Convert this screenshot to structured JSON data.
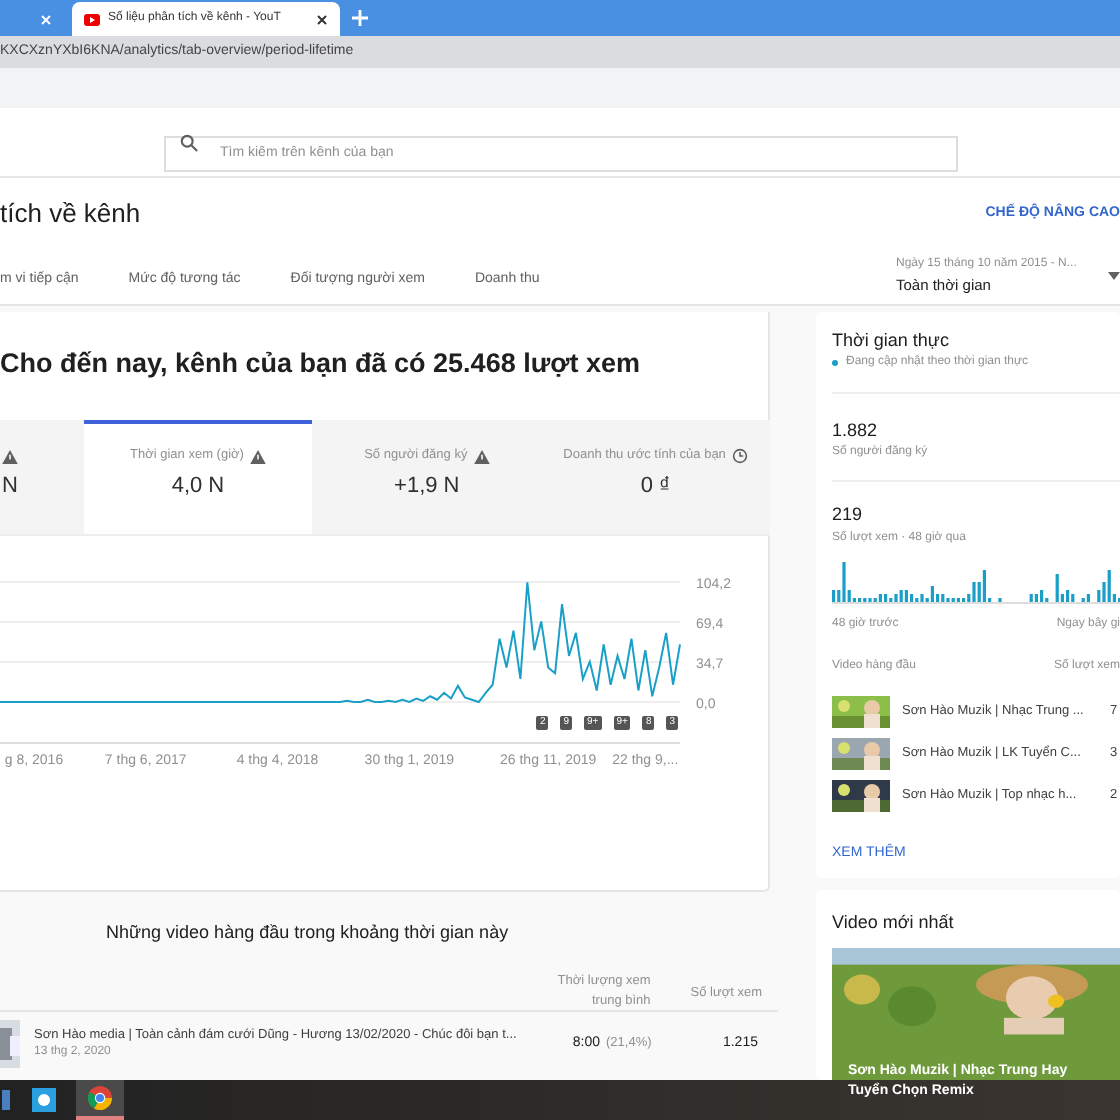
{
  "browser": {
    "tabs": [
      {
        "selected": false
      },
      {
        "title": "Số liệu phân tích về kênh - YouT",
        "selected": true
      }
    ],
    "url": "KXCXznYXbI6KNA/analytics/tab-overview/period-lifetime"
  },
  "search": {
    "placeholder": "Tìm kiếm trên kênh của bạn"
  },
  "page_title": "tích về kênh",
  "advanced_mode": "CHẾ ĐỘ NÂNG CAO",
  "nav_tabs": [
    {
      "label": "m vi tiếp cận",
      "selected": false
    },
    {
      "label": "Mức độ tương tác",
      "selected": false
    },
    {
      "label": "Đối tượng người xem",
      "selected": false
    },
    {
      "label": "Doanh thu",
      "selected": false
    }
  ],
  "date_range": {
    "range": "Ngày 15 tháng 10 năm 2015 - N...",
    "value": "Toàn thời gian"
  },
  "headline": "Cho đến nay, kênh của bạn đã có 25.468 lượt xem",
  "metrics": [
    {
      "value": "N",
      "selected": false
    },
    {
      "label": "Thời gian xem (giờ)",
      "value": "4,0 N",
      "selected": true
    },
    {
      "label": "Số người đăng ký",
      "value": "+1,9 N",
      "selected": false
    },
    {
      "label": "Doanh thu ước tính của bạn",
      "value": "0 ₫",
      "selected": false
    }
  ],
  "chart": {
    "chart_data": {
      "type": "line",
      "categories": [
        null,
        null,
        null,
        null,
        "g 8, 2016",
        null,
        null,
        null,
        null,
        null,
        null,
        null,
        null,
        null,
        null,
        null,
        null,
        null,
        null,
        null,
        null,
        "7 thg 6, 2017",
        null,
        null,
        null,
        null,
        null,
        null,
        null,
        null,
        null,
        null,
        null,
        null,
        null,
        null,
        null,
        null,
        null,
        null,
        "4 thg 4, 2018",
        null,
        null,
        null,
        null,
        null,
        null,
        null,
        null,
        null,
        null,
        null,
        null,
        null,
        null,
        null,
        null,
        null,
        null,
        "30 thg 1, 2019",
        null,
        null,
        null,
        null,
        null,
        null,
        null,
        null,
        null,
        null,
        null,
        null,
        null,
        null,
        null,
        null,
        null,
        null,
        null,
        "26 thg 11, 2019",
        null,
        null,
        null,
        null,
        null,
        null,
        null,
        null,
        null,
        null,
        null,
        null,
        null,
        "22 thg 9,...",
        null,
        null,
        null,
        null,
        null
      ],
      "ylim": [
        0,
        104.2
      ],
      "yticks": [
        {
          "value": 0,
          "label": "0,0"
        },
        {
          "value": 34.7,
          "label": "34,7"
        },
        {
          "value": 69.4,
          "label": "69,4"
        },
        {
          "value": 104.2,
          "label": "104,2"
        }
      ],
      "series": [
        {
          "color": "#1aa0c8",
          "values": [
            0,
            0,
            0,
            0,
            0,
            0,
            0,
            0,
            0,
            0,
            0,
            0,
            0,
            0,
            0,
            0,
            0,
            0,
            0,
            0,
            0,
            0,
            0,
            0,
            0,
            0,
            0,
            0,
            0,
            0,
            0,
            0,
            0,
            0,
            0,
            0,
            0,
            0,
            0,
            0,
            0,
            0,
            0,
            0,
            0,
            0,
            0,
            0,
            0,
            0,
            1,
            0,
            0,
            2,
            0,
            0,
            1,
            0,
            2,
            0,
            3,
            1,
            5,
            2,
            8,
            3,
            14,
            4,
            2,
            0,
            8,
            15,
            55,
            30,
            62,
            20,
            104,
            45,
            70,
            30,
            25,
            85,
            40,
            60,
            20,
            35,
            10,
            50,
            15,
            40,
            20,
            55,
            10,
            45,
            5,
            30,
            60,
            15,
            50
          ]
        }
      ]
    },
    "badges": [
      "2",
      "9",
      "9+",
      "9+",
      "8",
      "3"
    ]
  },
  "top_videos": {
    "title": "Những video hàng đầu trong khoảng thời gian này",
    "columns": [
      "Thời lượng xem trung bình",
      "Số lượt xem"
    ],
    "rows": [
      {
        "title": "Sơn Hào media | Toàn cảnh đám cưới Dũng - Hương 13/02/2020 - Chúc đôi bạn t...",
        "date": "13 thg 2, 2020",
        "duration": "8:00",
        "percent": "(21,4%)",
        "views": "1.215"
      }
    ]
  },
  "realtime": {
    "title": "Thời gian thực",
    "status": "Đang cập nhật theo thời gian thực",
    "subscribers": "1.882",
    "subscribers_label": "Số người đăng ký",
    "views": "219",
    "views_label": "Số lượt xem · 48 giờ qua",
    "axis_start": "48 giờ trước",
    "axis_end": "Ngay bây gi",
    "top_label": "Video hàng đầu",
    "views_col": "Số lượt xem",
    "videos": [
      {
        "title": "Sơn Hào Muzik | Nhạc Trung ...",
        "views": "7"
      },
      {
        "title": "Sơn Hào Muzik | LK Tuyển C...",
        "views": "3"
      },
      {
        "title": "Sơn Hào Muzik | Top nhạc h...",
        "views": "2"
      }
    ],
    "more": "XEM THÊM"
  },
  "latest": {
    "title": "Video mới nhất",
    "video_title": "Sơn Hào Muzik | Nhạc Trung Hay Tuyển Chọn Remix"
  },
  "taskbar": [
    {
      "selected": false
    },
    {
      "selected": false
    },
    {
      "selected": true
    }
  ]
}
